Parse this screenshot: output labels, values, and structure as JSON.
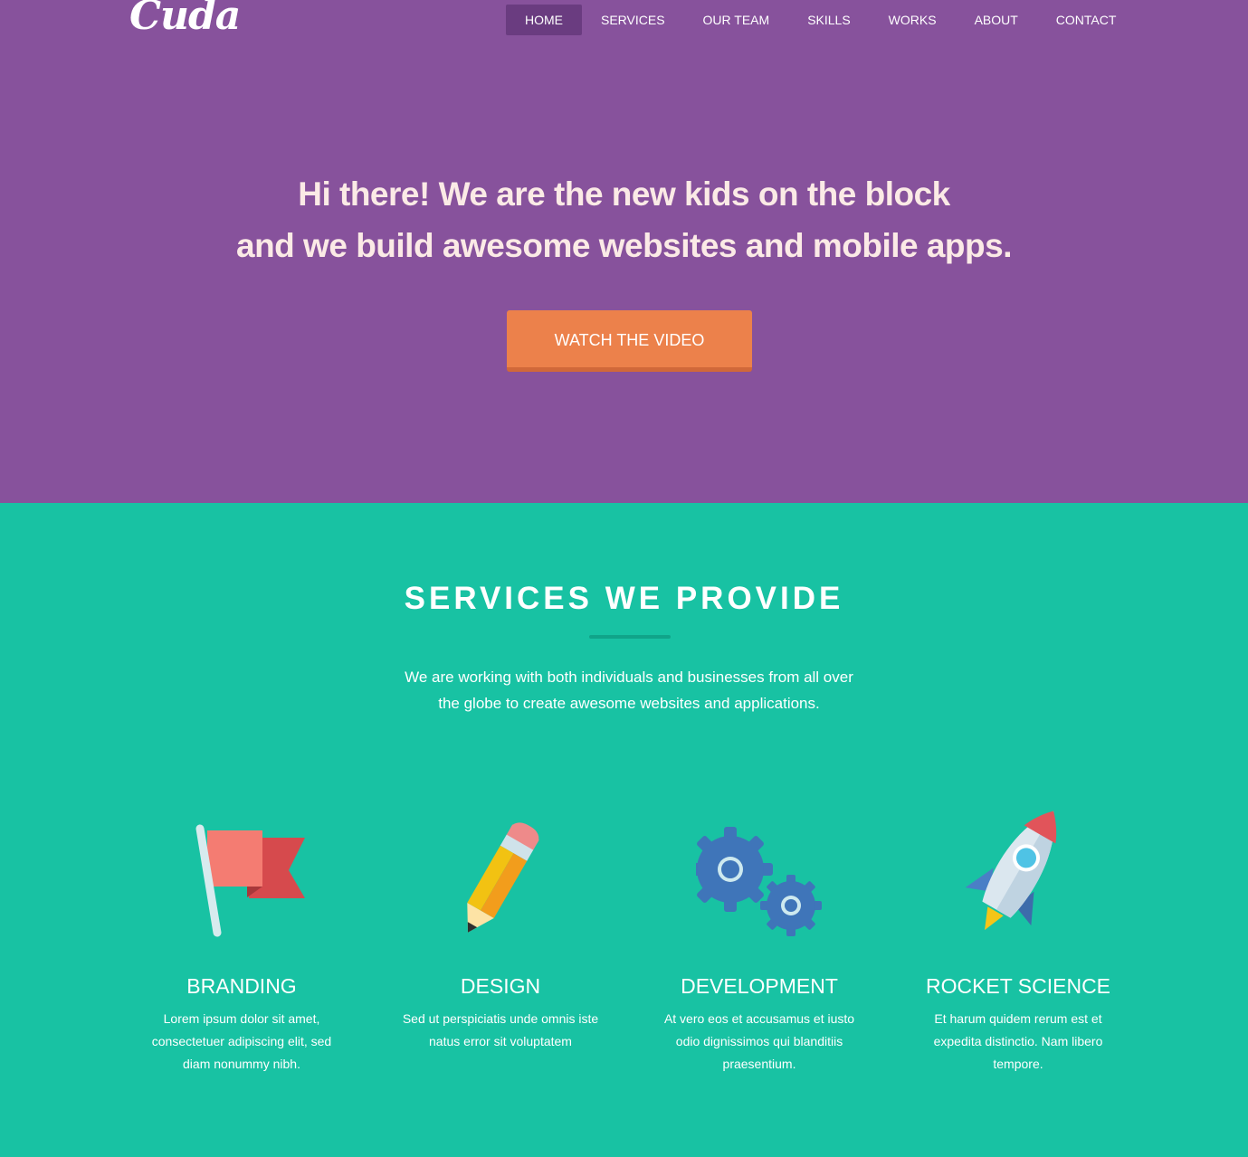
{
  "header": {
    "logo": "Cuda",
    "nav": [
      {
        "label": "HOME",
        "active": true
      },
      {
        "label": "SERVICES",
        "active": false
      },
      {
        "label": "OUR TEAM",
        "active": false
      },
      {
        "label": "SKILLS",
        "active": false
      },
      {
        "label": "WORKS",
        "active": false
      },
      {
        "label": "ABOUT",
        "active": false
      },
      {
        "label": "CONTACT",
        "active": false
      }
    ]
  },
  "hero": {
    "line1": "Hi there! We are the new kids on the block",
    "line2": "and we build awesome websites and mobile apps.",
    "cta": "WATCH THE VIDEO"
  },
  "services": {
    "title": "SERVICES WE PROVIDE",
    "intro_line1": "We are working with both individuals and businesses from all over",
    "intro_line2": "the globe to create awesome websites and applications.",
    "items": [
      {
        "icon": "flag-icon",
        "title": "BRANDING",
        "text": "Lorem ipsum dolor sit amet, consectetuer adipiscing elit, sed diam nonummy nibh."
      },
      {
        "icon": "pencil-icon",
        "title": "DESIGN",
        "text": "Sed ut perspiciatis unde omnis iste natus error sit voluptatem"
      },
      {
        "icon": "gears-icon",
        "title": "DEVELOPMENT",
        "text": "At vero eos et accusamus et iusto odio dignissimos qui blanditiis praesentium."
      },
      {
        "icon": "rocket-icon",
        "title": "ROCKET SCIENCE",
        "text": "Et harum quidem rerum est et expedita distinctio. Nam libero tempore."
      }
    ]
  },
  "colors": {
    "hero_bg": "#87529c",
    "nav_active": "#6a3c80",
    "services_bg": "#18c2a3",
    "cta": "#ec814b"
  }
}
